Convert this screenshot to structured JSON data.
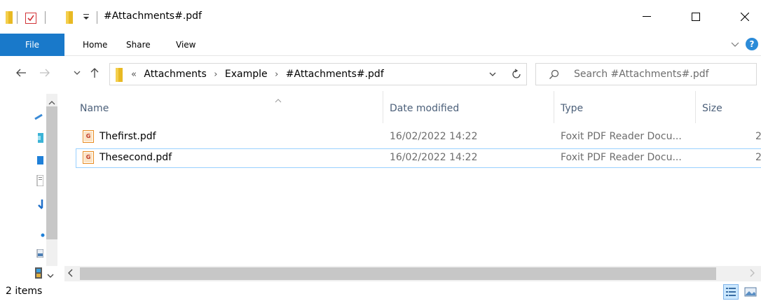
{
  "window": {
    "title": "#Attachments#.pdf"
  },
  "ribbon": {
    "tabs": [
      "File",
      "Home",
      "Share",
      "View"
    ],
    "help_label": "?"
  },
  "navigation": {
    "breadcrumb_prefix": "«",
    "breadcrumbs": [
      "Attachments",
      "Example",
      "#Attachments#.pdf"
    ],
    "search_placeholder": "Search #Attachments#.pdf"
  },
  "file_list": {
    "columns": [
      "Name",
      "Date modified",
      "Type",
      "Size"
    ],
    "rows": [
      {
        "name": "Thefirst.pdf",
        "date_modified": "16/02/2022 14:22",
        "type": "Foxit PDF Reader Docu...",
        "size": "2",
        "selected": false
      },
      {
        "name": "Thesecond.pdf",
        "date_modified": "16/02/2022 14:22",
        "type": "Foxit PDF Reader Docu...",
        "size": "2",
        "selected": true
      }
    ]
  },
  "status_bar": {
    "item_count": "2 items"
  },
  "colors": {
    "file_tab_bg": "#1979ca",
    "selection_border": "#99d1ff",
    "column_header_text": "#4c607a",
    "pdf_icon": "#e8891d"
  },
  "icons": [
    "folder-icon",
    "checkmark-icon",
    "back-arrow-icon",
    "forward-arrow-icon",
    "recent-locations-icon",
    "up-arrow-icon",
    "refresh-icon",
    "search-icon",
    "pdf-file-icon",
    "details-view-icon",
    "large-icons-view-icon"
  ]
}
